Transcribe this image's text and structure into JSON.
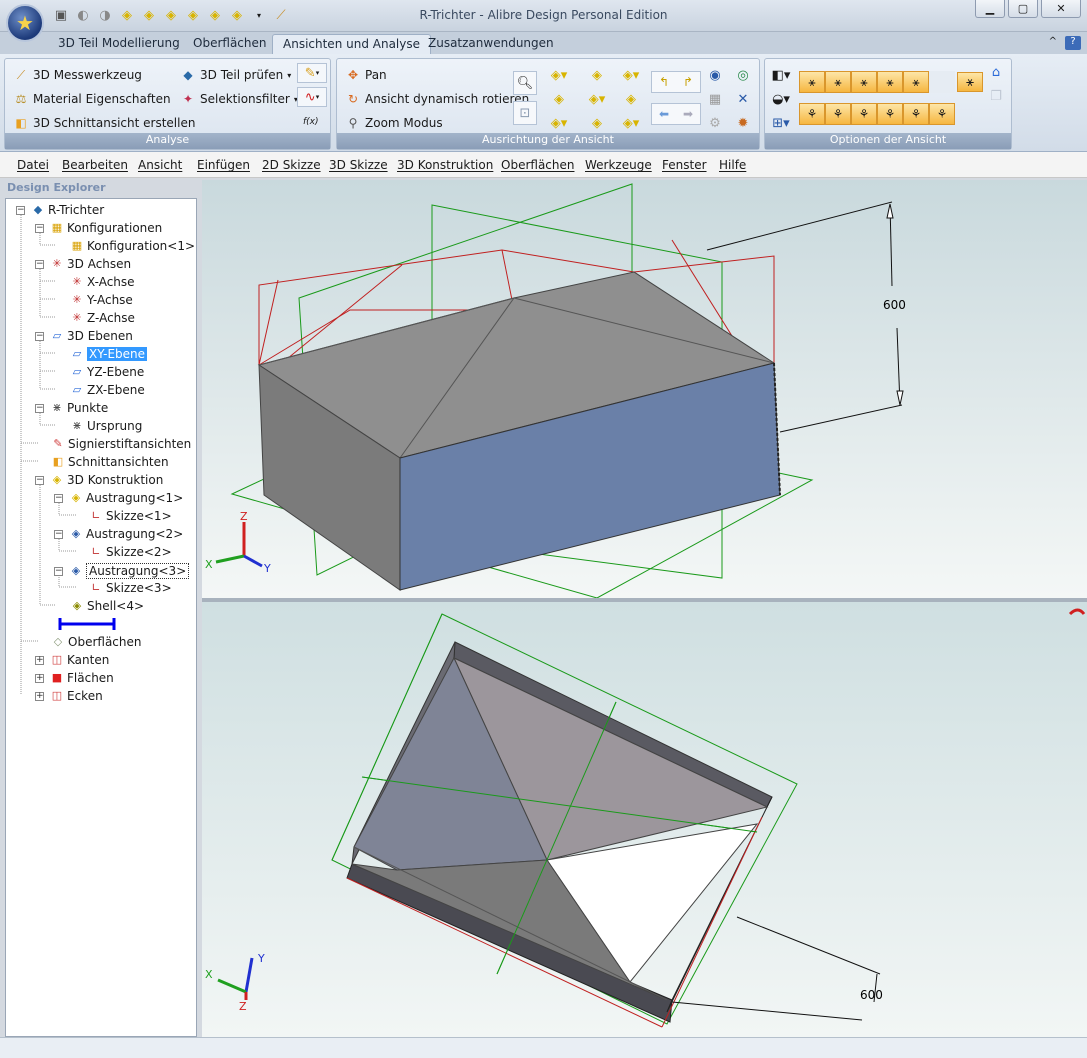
{
  "window": {
    "title": "R-Trichter - Alibre Design Personal Edition"
  },
  "ribbon_tabs": [
    "3D Teil Modellierung",
    "Oberflächen",
    "Ansichten und Analyse",
    "Zusatzanwendungen"
  ],
  "active_tab": "Ansichten und Analyse",
  "analyse": {
    "measure": "3D Messwerkzeug",
    "material": "Material Eigenschaften",
    "section": "3D Schnittansicht erstellen",
    "check": "3D Teil prüfen",
    "filter": "Selektionsfilter",
    "fx": "f(x)",
    "label": "Analyse"
  },
  "orient": {
    "pan": "Pan",
    "rotate": "Ansicht dynamisch rotieren",
    "zoom": "Zoom Modus",
    "label": "Ausrichtung der Ansicht"
  },
  "options": {
    "label": "Optionen der Ansicht"
  },
  "menu": [
    "Datei",
    "Bearbeiten",
    "Ansicht",
    "Einfügen",
    "2D Skizze",
    "3D Skizze",
    "3D Konstruktion",
    "Oberflächen",
    "Werkzeuge",
    "Fenster",
    "Hilfe"
  ],
  "explorer": {
    "title": "Design Explorer",
    "nodes": {
      "root": "R-Trichter",
      "konfigs": "Konfigurationen",
      "konfig1": "Konfiguration<1>",
      "achsen": "3D Achsen",
      "x": "X-Achse",
      "y": "Y-Achse",
      "z": "Z-Achse",
      "ebenen": "3D Ebenen",
      "xy": "XY-Ebene",
      "yz": "YZ-Ebene",
      "zx": "ZX-Ebene",
      "punkte": "Punkte",
      "ursprung": "Ursprung",
      "signier": "Signierstiftansichten",
      "schnitt": "Schnittansichten",
      "konstr": "3D Konstruktion",
      "a1": "Austragung<1>",
      "s1": "Skizze<1>",
      "a2": "Austragung<2>",
      "s2": "Skizze<2>",
      "a3": "Austragung<3>",
      "s3": "Skizze<3>",
      "shell": "Shell<4>",
      "oberfl": "Oberflächen",
      "kanten": "Kanten",
      "flaechen": "Flächen",
      "ecken": "Ecken"
    }
  },
  "viewport": {
    "top_dimension": "600",
    "bottom_dimension": "600",
    "axes": {
      "x": "X",
      "y": "Y",
      "z": "Z"
    }
  }
}
